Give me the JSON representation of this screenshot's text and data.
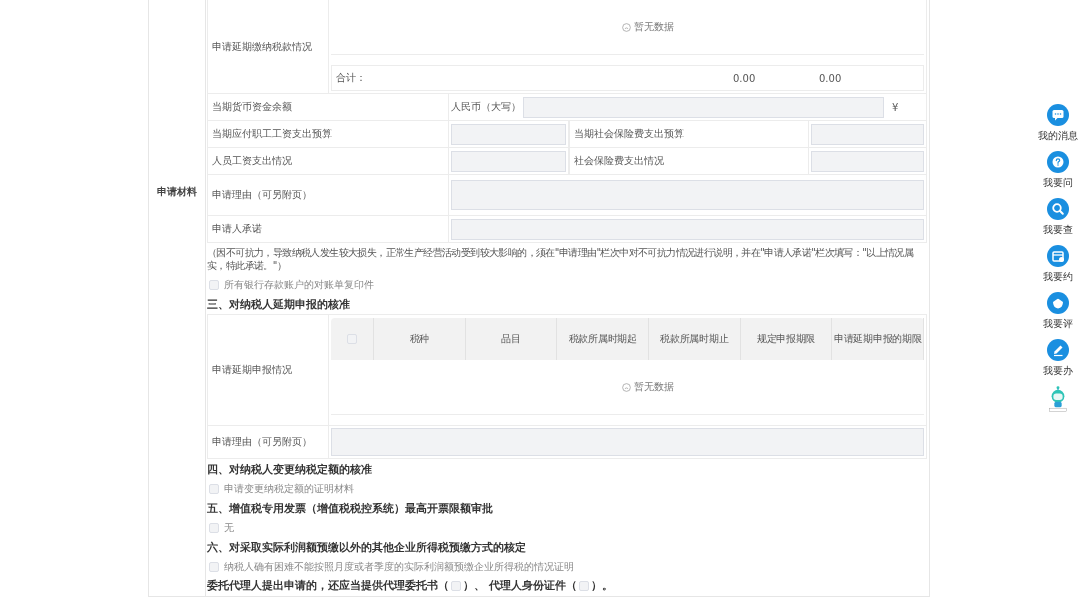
{
  "side_label": "申请材料",
  "payment": {
    "label": "申请延期缴纳税款情况",
    "empty_text": "暂无数据",
    "total_label": "合计：",
    "totals": [
      "0.00",
      "0.00"
    ]
  },
  "fund_row": {
    "label": "当期货币资金余额",
    "currency_label": "人民币（大写）",
    "unit": "¥"
  },
  "pair_rows": [
    {
      "label": "当期应付职工工资支出预算",
      "label2": "当期社会保险费支出预算"
    },
    {
      "label": "人员工资支出情况",
      "label2": "社会保险费支出情况"
    }
  ],
  "wide_rows": [
    {
      "label": "申请理由（可另附页）",
      "tall": true
    },
    {
      "label": "申请人承诺",
      "tall": false
    }
  ],
  "note": "（因不可抗力，导致纳税人发生较大损失，正常生产经营活动受到较大影响的，须在\"申请理由\"栏次中对不可抗力情况进行说明，并在\"申请人承诺\"栏次填写：\"以上情况属实，特此承诺。\"）",
  "items": [
    {
      "kind": "checkbox",
      "label": "所有银行存款账户的对账单复印件",
      "checked": false
    },
    {
      "kind": "heading",
      "text": "三、对纳税人延期申报的核准"
    },
    {
      "kind": "filing",
      "label": "申请延期申报情况",
      "select_all": false,
      "columns": [
        "税种",
        "品目",
        "税款所属时期起",
        "税款所属时期止",
        "规定申报期限",
        "申请延期申报的期限"
      ],
      "empty_text": "暂无数据",
      "reason_label": "申请理由（可另附页）"
    },
    {
      "kind": "heading",
      "text": "四、对纳税人变更纳税定额的核准"
    },
    {
      "kind": "checkbox",
      "label": "申请变更纳税定额的证明材料",
      "checked": false
    },
    {
      "kind": "heading",
      "text": "五、增值税专用发票（增值税税控系统）最高开票限额审批"
    },
    {
      "kind": "checkbox",
      "label": "无",
      "checked": false
    },
    {
      "kind": "heading",
      "text": "六、对采取实际利润额预缴以外的其他企业所得税预缴方式的核定"
    },
    {
      "kind": "checkbox",
      "label": "纳税人确有困难不能按照月度或者季度的实际利润额预缴企业所得税的情况证明",
      "checked": false
    },
    {
      "kind": "agent",
      "parts": [
        {
          "kind": "text",
          "text": "委托代理人提出申请的，还应当提供代理委托书（"
        },
        {
          "kind": "checkbox",
          "checked": false
        },
        {
          "kind": "text",
          "text": "）、 代理人身份证件（"
        },
        {
          "kind": "checkbox",
          "checked": false
        },
        {
          "kind": "text",
          "text": "）。"
        }
      ]
    }
  ],
  "float_menu": [
    {
      "kind": "button",
      "label": "我的消息"
    },
    {
      "kind": "button",
      "label": "我要问"
    },
    {
      "kind": "button",
      "label": "我要查"
    },
    {
      "kind": "button",
      "label": "我要约"
    },
    {
      "kind": "button",
      "label": "我要评"
    },
    {
      "kind": "button",
      "label": "我要办"
    },
    {
      "kind": "mascot"
    }
  ]
}
